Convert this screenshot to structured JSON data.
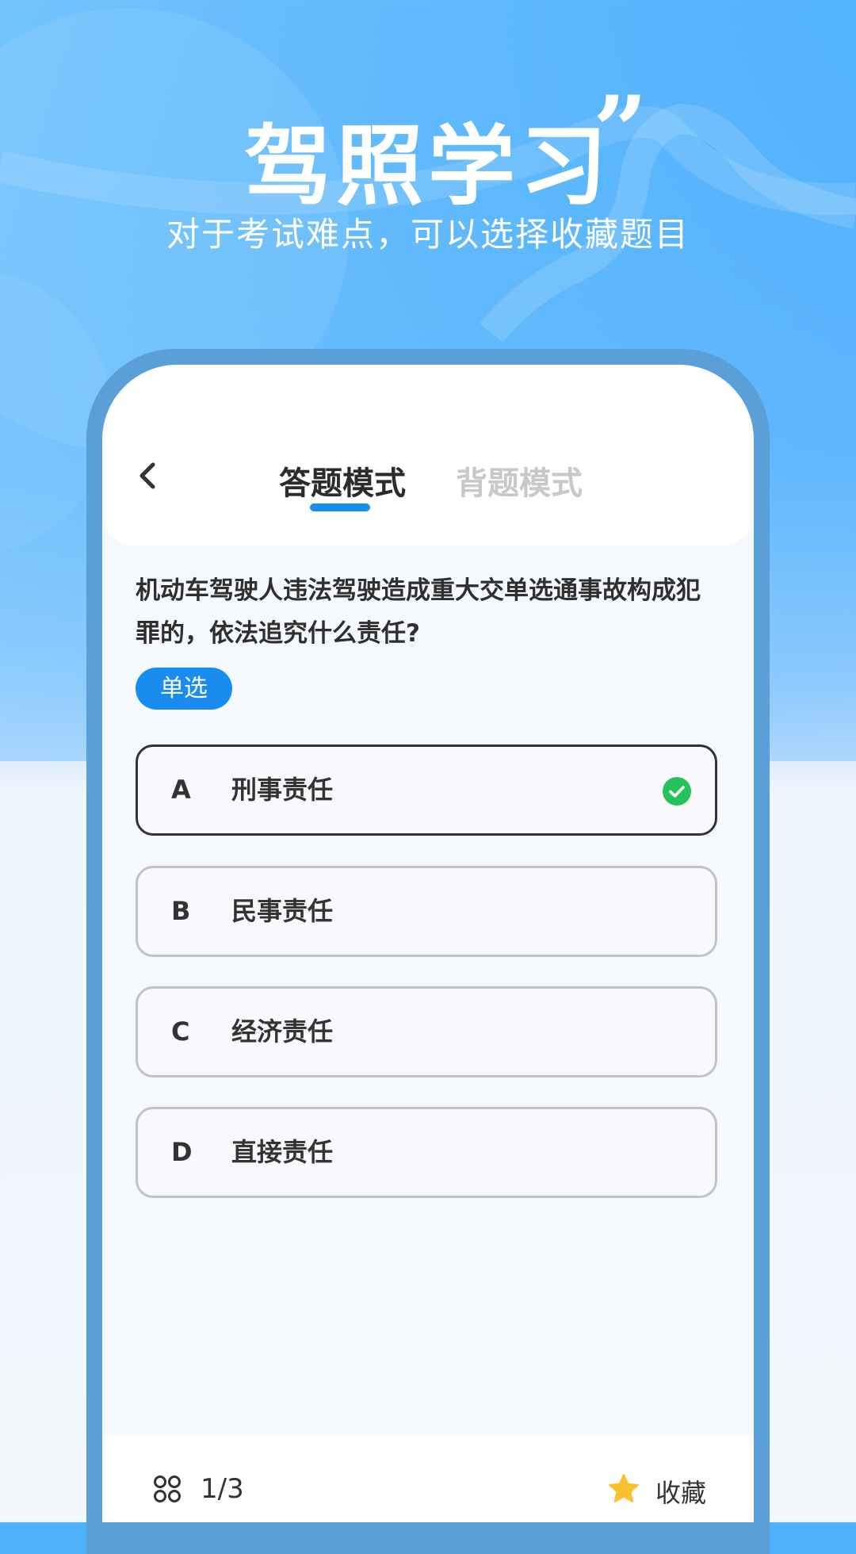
{
  "hero": {
    "title": "驾照学习",
    "quote_mark": "”",
    "subtitle": "对于考试难点，可以选择收藏题目"
  },
  "header": {
    "tabs": [
      {
        "label": "答题模式",
        "active": true
      },
      {
        "label": "背题模式",
        "active": false
      }
    ]
  },
  "question": {
    "text": "机动车驾驶人违法驾驶造成重大交单选通事故构成犯罪的，依法追究什么责任?",
    "type_badge": "单选"
  },
  "options": [
    {
      "letter": "A",
      "text": "刑事责任",
      "selected": true,
      "correct": true
    },
    {
      "letter": "B",
      "text": "民事责任",
      "selected": false
    },
    {
      "letter": "C",
      "text": "经济责任",
      "selected": false
    },
    {
      "letter": "D",
      "text": "直接责任",
      "selected": false
    }
  ],
  "footer": {
    "progress": "1/3",
    "favorite_label": "收藏"
  },
  "colors": {
    "accent": "#1a8cf0",
    "correct": "#27c15b",
    "star": "#fbc02d",
    "frame": "#5b9fd9"
  },
  "icons": [
    "back-chevron-icon",
    "check-circle-icon",
    "grid-icon",
    "star-icon"
  ]
}
